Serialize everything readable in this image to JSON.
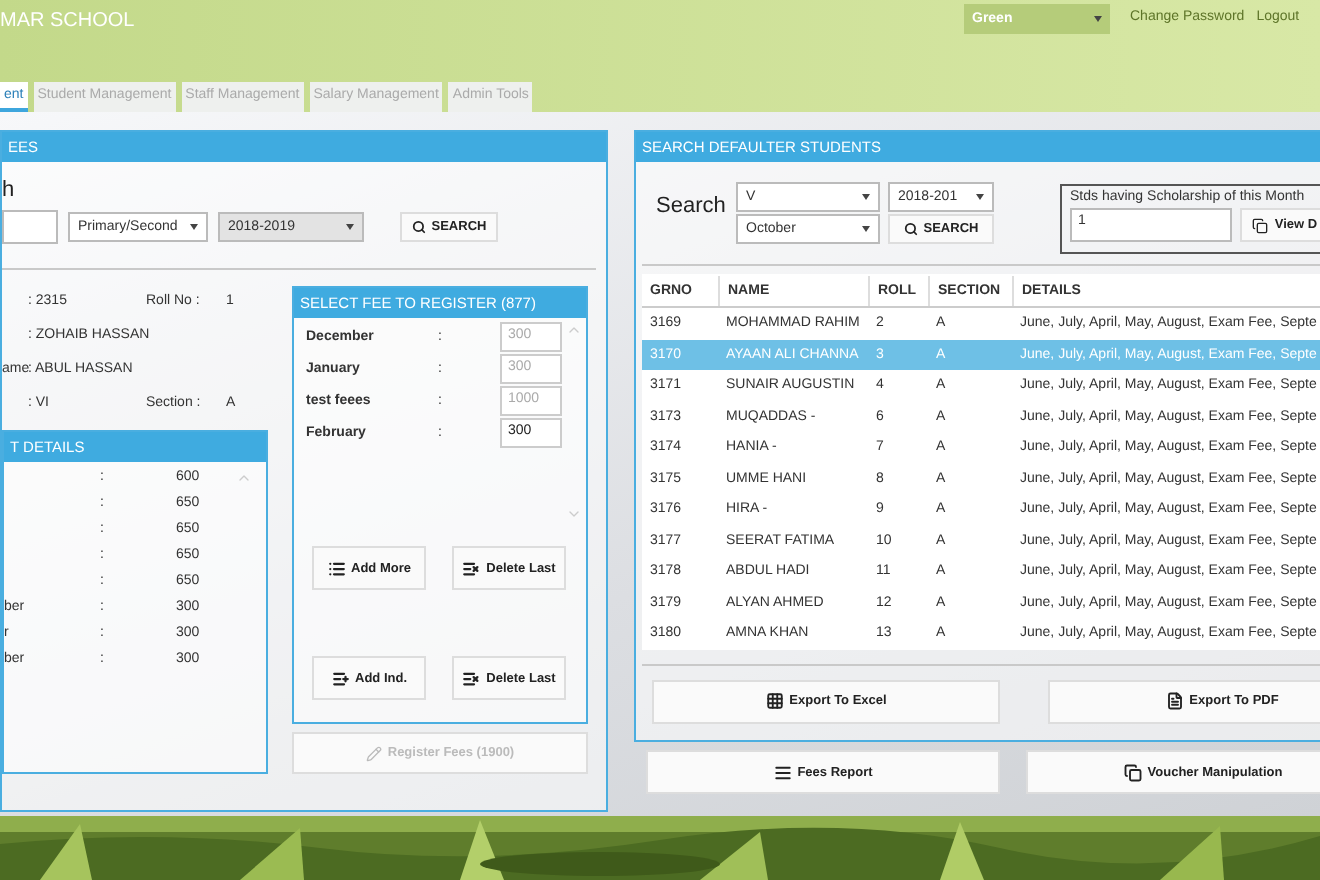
{
  "header": {
    "title": "MAR SCHOOL",
    "theme": "Green",
    "links": [
      "Change Password",
      "Logout"
    ]
  },
  "tabs": [
    {
      "label": "ent",
      "selected": true
    },
    {
      "label": "Student Management",
      "selected": false
    },
    {
      "label": "Staff Management",
      "selected": false
    },
    {
      "label": "Salary Management",
      "selected": false
    },
    {
      "label": "Admin Tools",
      "selected": false
    }
  ],
  "fee_panel": {
    "title": "EES",
    "search_label": "h",
    "class_select": "Primary/Second",
    "year_select": "2018-2019",
    "search_button": "SEARCH",
    "info": [
      {
        "value": ": 2315",
        "extra_label": "Roll No :",
        "extra_value": "1"
      },
      {
        "value": ": ZOHAIB HASSAN"
      },
      {
        "label": "ame",
        "value": ": ABUL HASSAN"
      },
      {
        "value": ": VI",
        "extra_label": "Section :",
        "extra_value": "A"
      }
    ],
    "details": {
      "title": "T DETAILS",
      "rows": [
        {
          "sep": ":",
          "value": "600"
        },
        {
          "sep": ":",
          "value": "650"
        },
        {
          "sep": ":",
          "value": "650"
        },
        {
          "sep": ":",
          "value": "650"
        },
        {
          "sep": ":",
          "value": "650"
        },
        {
          "label": "ber",
          "sep": ":",
          "value": "300"
        },
        {
          "label": "r",
          "sep": ":",
          "value": "300"
        },
        {
          "label": "ber",
          "sep": ":",
          "value": "300"
        }
      ]
    },
    "select_fee": {
      "title": "SELECT FEE TO REGISTER (877)",
      "rows": [
        {
          "month": "December",
          "sep": ":",
          "amount": "300",
          "disabled": true
        },
        {
          "month": "January",
          "sep": ":",
          "amount": "300",
          "disabled": true
        },
        {
          "month": "test feees",
          "sep": ":",
          "amount": "1000",
          "disabled": true
        },
        {
          "month": "February",
          "sep": ":",
          "amount": "300",
          "disabled": false
        }
      ],
      "buttons": [
        "Add More",
        "Delete Last",
        "Add Ind.",
        "Delete Last"
      ]
    },
    "register_button": {
      "label": "Register Fees (1900)",
      "disabled": true
    }
  },
  "defaulters": {
    "title": "SEARCH DEFAULTER STUDENTS",
    "search_label": "Search",
    "class_select": "V",
    "year_select": "2018-201",
    "month_select": "October",
    "search_button": "SEARCH",
    "scholarship": {
      "label": "Stds having Scholarship of this Month",
      "value": "1",
      "button": "View D"
    },
    "table": {
      "columns": [
        "GRNO",
        "NAME",
        "ROLL",
        "SECTION",
        "DETAILS"
      ],
      "rows": [
        {
          "selected": false,
          "cells": [
            "3169",
            "MOHAMMAD RAHIM",
            "2",
            "A",
            "June, July, April, May, August, Exam Fee, Septe"
          ]
        },
        {
          "selected": true,
          "cells": [
            "3170",
            "AYAAN ALI CHANNA",
            "3",
            "A",
            "June, July, April, May, August, Exam Fee, Septe"
          ]
        },
        {
          "selected": false,
          "cells": [
            "3171",
            "SUNAIR AUGUSTIN",
            "4",
            "A",
            "June, July, April, May, August, Exam Fee, Septe"
          ]
        },
        {
          "selected": false,
          "cells": [
            "3173",
            "MUQADDAS -",
            "6",
            "A",
            "June, July, April, May, August, Exam Fee, Septe"
          ]
        },
        {
          "selected": false,
          "cells": [
            "3174",
            "HANIA -",
            "7",
            "A",
            "June, July, April, May, August, Exam Fee, Septe"
          ]
        },
        {
          "selected": false,
          "cells": [
            "3175",
            "UMME HANI",
            "8",
            "A",
            "June, July, April, May, August, Exam Fee, Septe"
          ]
        },
        {
          "selected": false,
          "cells": [
            "3176",
            "HIRA -",
            "9",
            "A",
            "June, July, April, May, August, Exam Fee, Septe"
          ]
        },
        {
          "selected": false,
          "cells": [
            "3177",
            "SEERAT FATIMA",
            "10",
            "A",
            "June, July, April, May, August, Exam Fee, Septe"
          ]
        },
        {
          "selected": false,
          "cells": [
            "3178",
            "ABDUL HADI",
            "11",
            "A",
            "June, July, April, May, August, Exam Fee, Septe"
          ]
        },
        {
          "selected": false,
          "cells": [
            "3179",
            "ALYAN AHMED",
            "12",
            "A",
            "June, July, April, May, August, Exam Fee, Septe"
          ]
        },
        {
          "selected": false,
          "cells": [
            "3180",
            "AMNA KHAN",
            "13",
            "A",
            "June, July, April, May, August, Exam Fee, Septe"
          ]
        }
      ]
    },
    "export_buttons": [
      "Export To Excel",
      "Export To PDF"
    ]
  },
  "bottom_buttons": [
    "Fees Report",
    "Voucher Manipulation"
  ]
}
